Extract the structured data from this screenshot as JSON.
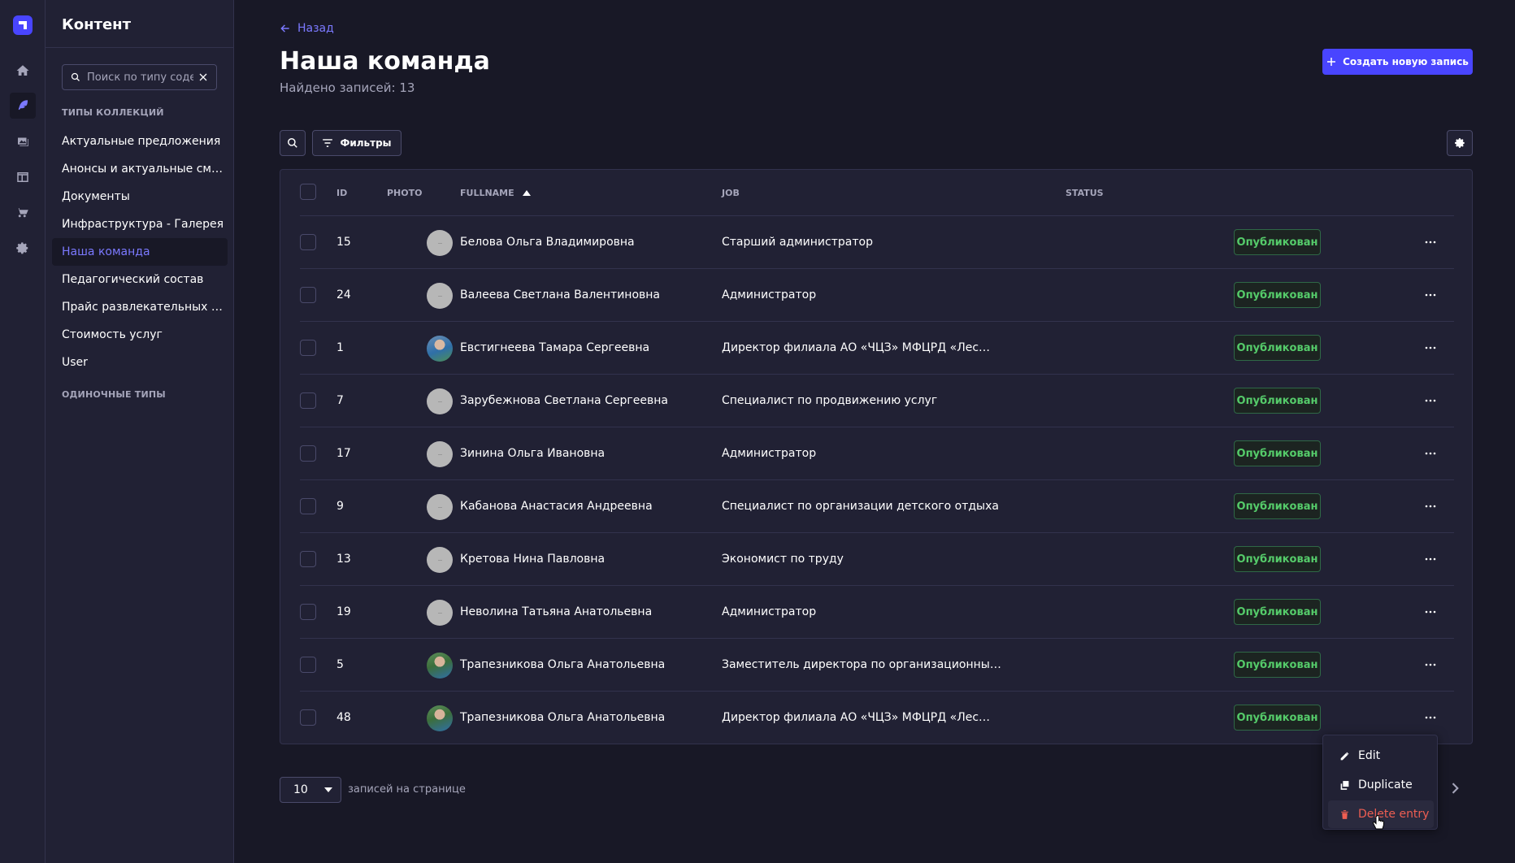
{
  "colors": {
    "background": "#181826",
    "panel": "#212134",
    "accent": "#4945ff",
    "accent_text": "#7b79ff",
    "published": "#55cb6a",
    "danger": "#ee5e52"
  },
  "rail": {
    "items": [
      "home-icon",
      "feather-icon",
      "media-icon",
      "layout-icon",
      "cart-icon",
      "gear-icon"
    ],
    "active_index": 1
  },
  "sidebar": {
    "title": "Контент",
    "search_placeholder": "Поиск по типу содержимого",
    "collection_types_label": "ТИПЫ КОЛЛЕКЦИЙ",
    "items": [
      {
        "label": "Актуальные предложения"
      },
      {
        "label": "Анонсы и актуальные смены"
      },
      {
        "label": "Документы"
      },
      {
        "label": "Инфраструктура - Галерея"
      },
      {
        "label": "Наша команда"
      },
      {
        "label": "Педагогический состав"
      },
      {
        "label": "Прайс развлекательных программ"
      },
      {
        "label": "Стоимость услуг"
      },
      {
        "label": "User"
      }
    ],
    "active_index": 4,
    "single_types_label": "ОДИНОЧНЫЕ ТИПЫ"
  },
  "header": {
    "back_label": "Назад",
    "title": "Наша команда",
    "subtitle": "Найдено записей: 13",
    "create_label": "Создать новую запись"
  },
  "toolbar": {
    "filters_label": "Фильтры"
  },
  "table": {
    "columns": [
      "ID",
      "PHOTO",
      "FULLNAME",
      "JOB",
      "STATUS"
    ],
    "sort_column": "FULLNAME",
    "sort_direction": "asc",
    "rows": [
      {
        "id": "15",
        "photo": "placeholder",
        "fullname": "Белова Ольга Владимировна",
        "job": "Старший администратор",
        "status": "Опубликован"
      },
      {
        "id": "24",
        "photo": "placeholder",
        "fullname": "Валеева Светлана Валентиновна",
        "job": "Администратор",
        "status": "Опубликован"
      },
      {
        "id": "1",
        "photo": "photo-blue",
        "fullname": "Евстигнеева Тамара Сергеевна",
        "job": "Директор филиала АО «ЧЦЗ» МФЦРД «Лес…",
        "status": "Опубликован"
      },
      {
        "id": "7",
        "photo": "placeholder",
        "fullname": "Зарубежнова Светлана Сергеевна",
        "job": "Специалист по продвижению услуг",
        "status": "Опубликован"
      },
      {
        "id": "17",
        "photo": "placeholder",
        "fullname": "Зинина Ольга Ивановна",
        "job": "Администратор",
        "status": "Опубликован"
      },
      {
        "id": "9",
        "photo": "placeholder",
        "fullname": "Кабанова Анастасия Андреевна",
        "job": "Специалист по организации детского отдыха",
        "status": "Опубликован"
      },
      {
        "id": "13",
        "photo": "placeholder",
        "fullname": "Кретова Нина Павловна",
        "job": "Экономист по труду",
        "status": "Опубликован"
      },
      {
        "id": "19",
        "photo": "placeholder",
        "fullname": "Неволина Татьяна Анатольевна",
        "job": "Администратор",
        "status": "Опубликован"
      },
      {
        "id": "5",
        "photo": "photo-green",
        "fullname": "Трапезникова Ольга Анатольевна",
        "job": "Заместитель директора по организационны…",
        "status": "Опубликован"
      },
      {
        "id": "48",
        "photo": "photo-green",
        "fullname": "Трапезникова Ольга Анатольевна",
        "job": "Директор филиала АО «ЧЦЗ» МФЦРД «Лес…",
        "status": "Опубликован"
      }
    ]
  },
  "pagination": {
    "page_size": "10",
    "page_size_label": "записей на странице"
  },
  "context_menu": {
    "edit_label": "Edit",
    "duplicate_label": "Duplicate",
    "delete_label": "Delete entry"
  }
}
